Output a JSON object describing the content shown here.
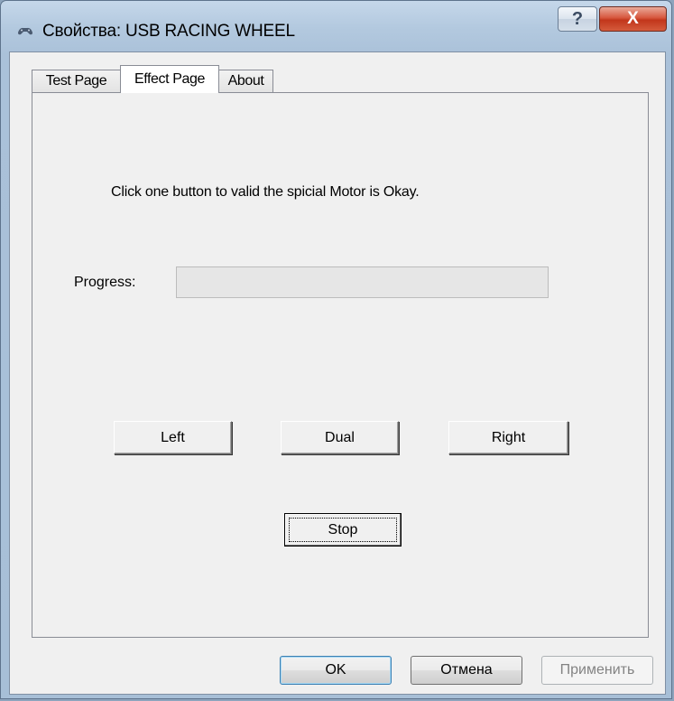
{
  "window": {
    "title": "Свойства: USB RACING WHEEL",
    "help_glyph": "?",
    "close_glyph": "X"
  },
  "tabs": [
    {
      "label": "Test Page",
      "active": false
    },
    {
      "label": "Effect Page",
      "active": true
    },
    {
      "label": "About",
      "active": false
    }
  ],
  "effect_page": {
    "instruction": "Click one button to valid the spicial Motor is Okay.",
    "progress_label": "Progress:",
    "progress_value": 0,
    "buttons": {
      "left": "Left",
      "dual": "Dual",
      "right": "Right",
      "stop": "Stop"
    }
  },
  "dialog_buttons": {
    "ok": "OK",
    "cancel": "Отмена",
    "apply": "Применить"
  }
}
